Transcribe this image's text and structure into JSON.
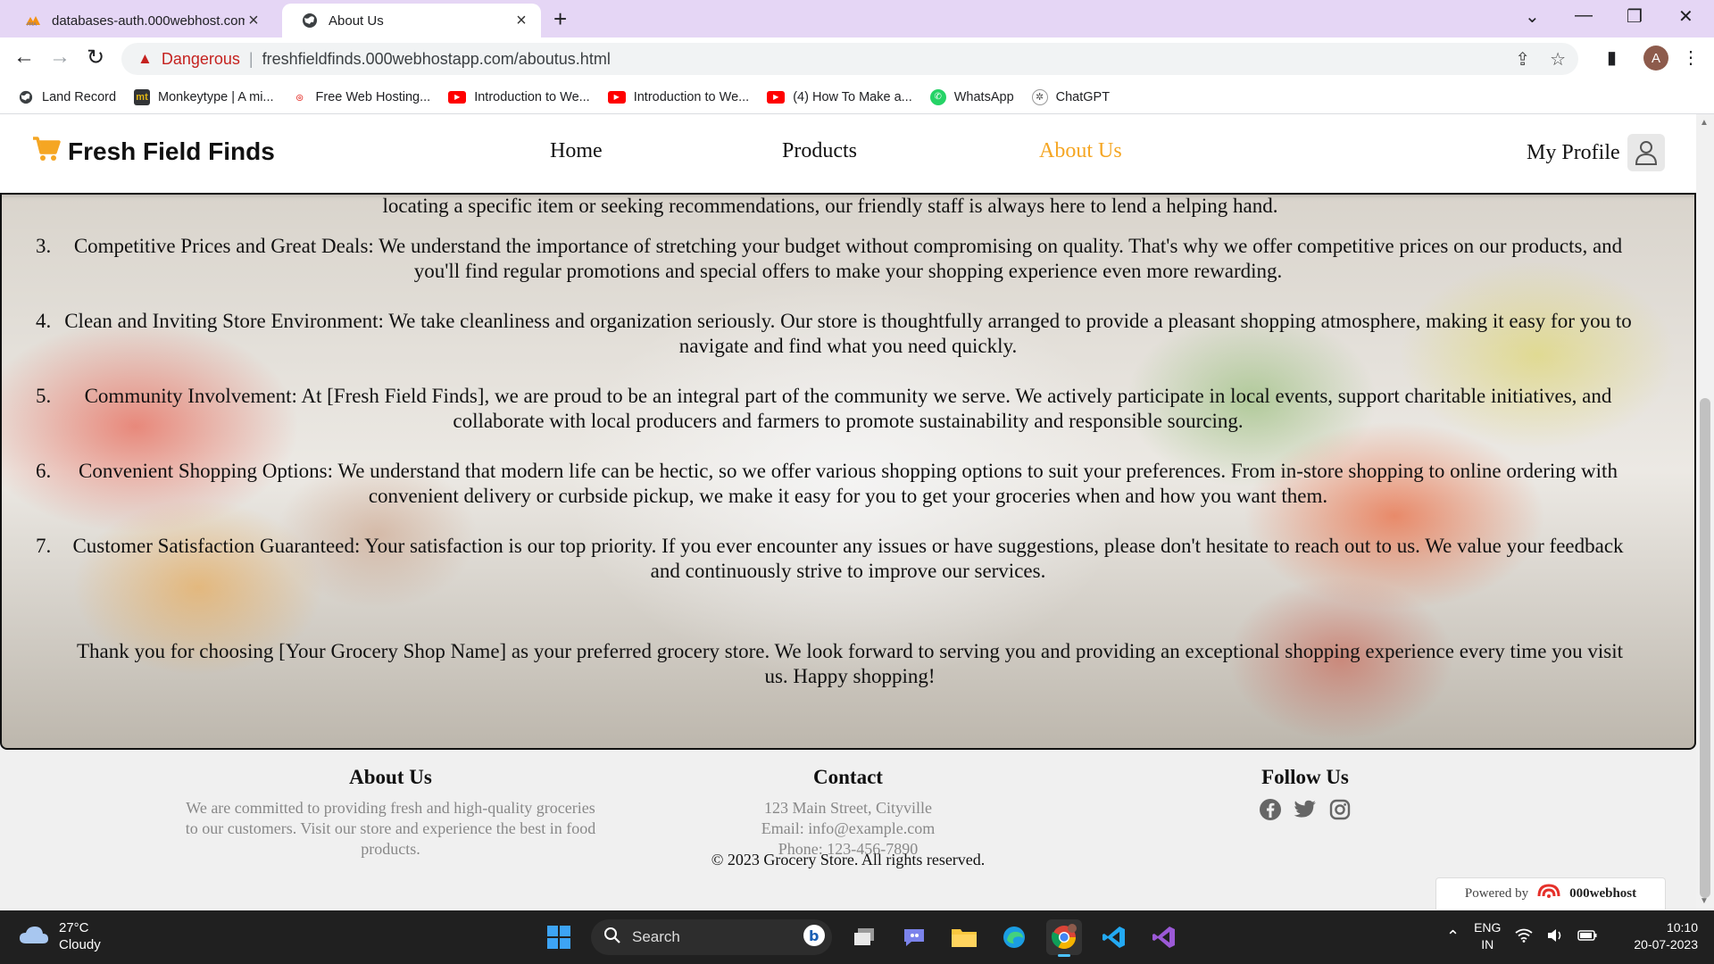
{
  "browser": {
    "tabs": [
      {
        "title": "databases-auth.000webhost.com",
        "icon": "phpmyadmin-icon",
        "active": false
      },
      {
        "title": "About Us",
        "icon": "globe-icon",
        "active": true
      }
    ],
    "security_label": "Dangerous",
    "url": "freshfieldfinds.000webhostapp.com/aboutus.html",
    "profile_initial": "A",
    "bookmarks": [
      {
        "label": "Land Record",
        "icon": "globe-icon"
      },
      {
        "label": "Monkeytype | A mi...",
        "icon": "monkeytype-icon"
      },
      {
        "label": "Free Web Hosting...",
        "icon": "000webhost-icon"
      },
      {
        "label": "Introduction to We...",
        "icon": "youtube-icon"
      },
      {
        "label": "Introduction to We...",
        "icon": "youtube-icon"
      },
      {
        "label": "(4) How To Make a...",
        "icon": "youtube-icon"
      },
      {
        "label": "WhatsApp",
        "icon": "whatsapp-icon"
      },
      {
        "label": "ChatGPT",
        "icon": "chatgpt-icon"
      }
    ]
  },
  "site": {
    "brand": "Fresh Field Finds",
    "nav": [
      "Home",
      "Products",
      "About Us"
    ],
    "active_nav": "About Us",
    "profile_label": "My Profile",
    "accent_color": "#f5a623"
  },
  "content": {
    "partial_line": "locating a specific item or seeking recommendations, our friendly staff is always here to lend a helping hand.",
    "items": [
      {
        "num": "3.",
        "text": "Competitive Prices and Great Deals: We understand the importance of stretching your budget without compromising on quality. That's why we offer competitive prices on our products, and you'll find regular promotions and special offers to make your shopping experience even more rewarding."
      },
      {
        "num": "4.",
        "text": "Clean and Inviting Store Environment: We take cleanliness and organization seriously. Our store is thoughtfully arranged to provide a pleasant shopping atmosphere, making it easy for you to navigate and find what you need quickly."
      },
      {
        "num": "5.",
        "text": "Community Involvement: At [Fresh Field Finds], we are proud to be an integral part of the community we serve. We actively participate in local events, support charitable initiatives, and collaborate with local producers and farmers to promote sustainability and responsible sourcing."
      },
      {
        "num": "6.",
        "text": "Convenient Shopping Options: We understand that modern life can be hectic, so we offer various shopping options to suit your preferences. From in-store shopping to online ordering with convenient delivery or curbside pickup, we make it easy for you to get your groceries when and how you want them."
      },
      {
        "num": "7.",
        "text": "Customer Satisfaction Guaranteed: Your satisfaction is our top priority. If you ever encounter any issues or have suggestions, please don't hesitate to reach out to us. We value your feedback and continuously strive to improve our services."
      }
    ],
    "thanks": "Thank you for choosing [Your Grocery Shop Name] as your preferred grocery store. We look forward to serving you and providing an exceptional shopping experience every time you visit us. Happy shopping!"
  },
  "footer": {
    "about_title": "About Us",
    "about_text": "We are committed to providing fresh and high-quality groceries to our customers. Visit our store and experience the best in food products.",
    "contact_title": "Contact",
    "address": "123 Main Street, Cityville",
    "email": "Email: info@example.com",
    "phone": "Phone: 123-456-7890",
    "follow_title": "Follow Us",
    "social": [
      "facebook-icon",
      "twitter-icon",
      "instagram-icon"
    ],
    "copyright": "© 2023 Grocery Store. All rights reserved.",
    "powered_by": "Powered by",
    "powered_brand": "000webhost"
  },
  "taskbar": {
    "temperature": "27°C",
    "condition": "Cloudy",
    "search_label": "Search",
    "lang_1": "ENG",
    "lang_2": "IN",
    "time": "10:10",
    "date": "20-07-2023"
  }
}
